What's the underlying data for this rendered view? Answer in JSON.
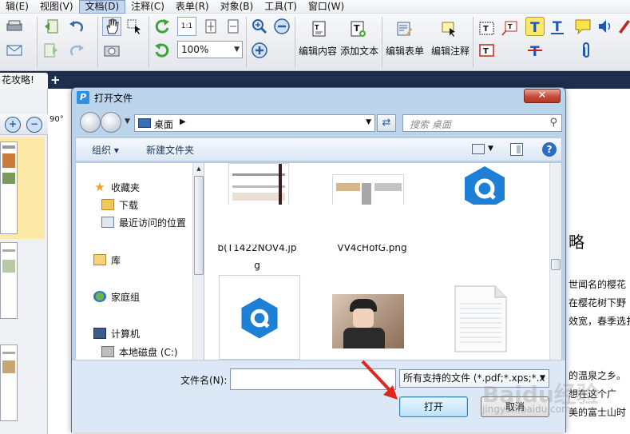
{
  "menubar": {
    "items": [
      "辑(E)",
      "视图(V)",
      "文档(D)",
      "注释(C)",
      "表单(R)",
      "对象(B)",
      "工具(T)",
      "窗口(W)"
    ],
    "active_index": 2
  },
  "toolbar": {
    "zoom_value": "100%",
    "labels": {
      "edit_content": "编辑内容",
      "add_text": "添加文本",
      "edit_form": "编辑表单",
      "edit_annotation": "编辑注释"
    },
    "actual_size_label": "1:1"
  },
  "tabs": {
    "doc_tab": "花攻略!",
    "add_label": "+"
  },
  "left_panel": {
    "rotate_label": "90°"
  },
  "document": {
    "heading": "略",
    "lines": [
      "世闻名的樱花",
      "在樱花树下野",
      "效宽，春季选扌",
      "的温泉之乡。",
      "想在这个广",
      "美的富士山时"
    ]
  },
  "watermark": {
    "main": "Baidu经验",
    "sub": "jingyan.baidu.com"
  },
  "dialog": {
    "title": "打开文件",
    "close_label": "✕",
    "address": "桌面",
    "search_placeholder": "搜索 桌面",
    "commands": {
      "organize": "组织 ▾",
      "new_folder": "新建文件夹"
    },
    "nav_items": [
      {
        "label": "收藏夹",
        "icon": "star-icon"
      },
      {
        "label": "下载",
        "icon": "folder-icon"
      },
      {
        "label": "最近访问的位置",
        "icon": "recent-places-icon"
      },
      {
        "label": "库",
        "icon": "library-icon"
      },
      {
        "label": "家庭组",
        "icon": "homegroup-icon"
      },
      {
        "label": "计算机",
        "icon": "computer-icon"
      },
      {
        "label": "本地磁盘 (C:)",
        "icon": "disk-icon"
      }
    ],
    "files": [
      {
        "name_line1": "b(T1422NOV4.jp",
        "name_line2": "g",
        "type": "screenshot"
      },
      {
        "name_line1": "VV4cHofG.png",
        "name_line2": "",
        "type": "screenshot"
      },
      {
        "name_line1": "",
        "name_line2": "",
        "type": "app-logo"
      },
      {
        "name_line1": "",
        "name_line2": "",
        "type": "app-logo"
      },
      {
        "name_line1": "",
        "name_line2": "",
        "type": "photo"
      },
      {
        "name_line1": "",
        "name_line2": "",
        "type": "text-document"
      }
    ],
    "filename_label": "文件名(N):",
    "filename_value": "",
    "filter_value": "所有支持的文件 (*.pdf;*.xps;*.x",
    "open_button": "打开",
    "cancel_button": "取消"
  },
  "colors": {
    "tab_strip": "#1e2f4d",
    "dialog_frame": "#bcd3ec",
    "close_button": "#c7493a",
    "arrow": "#e0261e",
    "logo_blue": "#1e7fd6"
  }
}
